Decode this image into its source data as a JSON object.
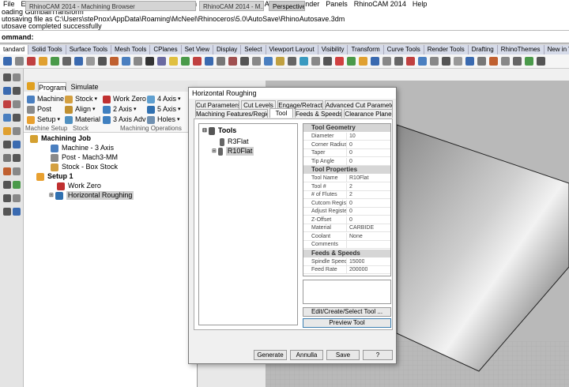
{
  "menu": [
    "File",
    "Edit",
    "View",
    "Curve",
    "Surface",
    "Solid",
    "Mesh",
    "Dimension",
    "Transform",
    "Tools",
    "Analyze",
    "Render",
    "Panels",
    "RhinoCAM 2014",
    "Help"
  ],
  "command_history": [
    "oading GumballTransform",
    "utosaving file as C:\\Users\\stePnox\\AppData\\Roaming\\McNeel\\Rhinoceros\\5.0\\AutoSave\\RhinoAutosave.3dm",
    "utosave completed successfully"
  ],
  "command_prompt": "ommand:",
  "toolbar_tabs": [
    "tandard",
    "Solid Tools",
    "Surface Tools",
    "Mesh Tools",
    "CPlanes",
    "Set View",
    "Display",
    "Select",
    "Viewport Layout",
    "Visibility",
    "Transform",
    "Curve Tools",
    "Render Tools",
    "Drafting",
    "RhinoThemes",
    "New in V5"
  ],
  "panel_titles": {
    "machining_browser": "RhinoCAM 2014 - Machining Browser",
    "second_panel": "RhinoCAM 2014 - M...",
    "viewport": "Perspective"
  },
  "browser": {
    "tabs": [
      "Program",
      "Simulate"
    ],
    "ribbon": {
      "machine": "Machine",
      "post": "Post",
      "setup": "Setup",
      "stock": "Stock",
      "align": "Align",
      "material": "Material",
      "work_zero": "Work Zero",
      "axis2": "2 Axis",
      "axis3_adv": "3 Axis Adv",
      "axis4": "4 Axis",
      "axis5": "5 Axis",
      "holes": "Holes",
      "group_setup": "Machine Setup",
      "group_stock": "Stock",
      "group_ops": "Machining Operations"
    },
    "tree": {
      "job": "Machining Job",
      "machine": "Machine - 3 Axis",
      "post": "Post - Mach3-MM",
      "stock": "Stock - Box Stock",
      "setup": "Setup 1",
      "work_zero": "Work Zero",
      "op": "Horizontal Roughing"
    }
  },
  "dialog": {
    "title": "Horizontal Roughing",
    "tabs_row1": [
      "Cut Parameters",
      "Cut Levels",
      "Engage/Retract",
      "Advanced Cut Parameters"
    ],
    "tabs_row2": [
      "Machining Features/Regions",
      "Tool",
      "Feeds & Speeds",
      "Clearance Plane"
    ],
    "tools_root": "Tools",
    "tools": [
      "R3Flat",
      "R10Flat"
    ],
    "properties": [
      {
        "category": "Tool Geometry",
        "rows": [
          [
            "Diameter",
            "10"
          ],
          [
            "Corner Radius",
            "0"
          ],
          [
            "Taper",
            "0"
          ],
          [
            "Tip Angle",
            "0"
          ]
        ]
      },
      {
        "category": "Tool Properties",
        "rows": [
          [
            "Tool Name",
            "R10Flat"
          ],
          [
            "Tool #",
            "2"
          ],
          [
            "# of Flutes",
            "2"
          ],
          [
            "Cutcom Registe",
            "0"
          ],
          [
            "Adjust Register",
            "0"
          ],
          [
            "Z-Offset",
            "0"
          ],
          [
            "Material",
            "CARBIDE"
          ],
          [
            "Coolant",
            "None"
          ],
          [
            "Comments",
            ""
          ]
        ]
      },
      {
        "category": "Feeds & Speeds",
        "rows": [
          [
            "Spindle Speed",
            "15000"
          ],
          [
            "Feed Rate",
            "200000"
          ]
        ]
      }
    ],
    "edit_button": "Edit/Create/Select Tool ...",
    "preview_button": "Preview Tool",
    "footer": [
      "Generate",
      "Annulla",
      "Save",
      "?"
    ]
  }
}
